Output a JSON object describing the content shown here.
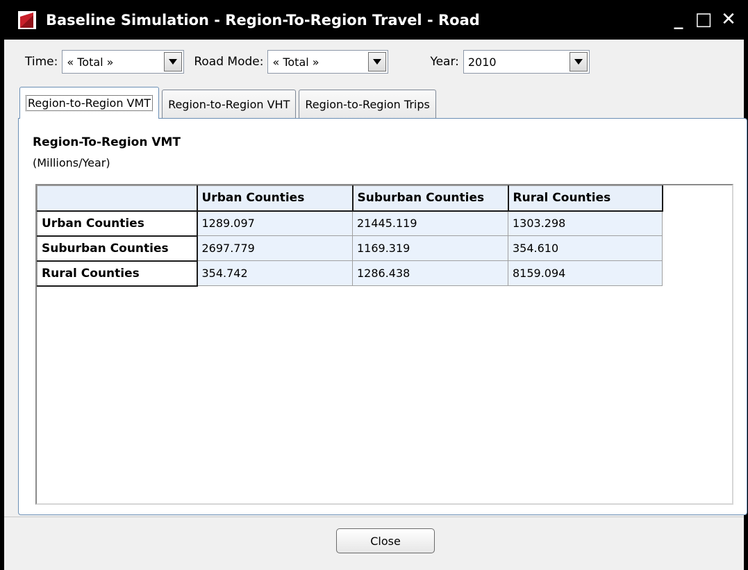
{
  "window": {
    "title": "Baseline Simulation - Region-To-Region Travel - Road",
    "minimize_glyph": "_",
    "maximize_glyph": "□",
    "close_glyph": "✕"
  },
  "toolbar": {
    "time_label": "Time:",
    "time_value": "« Total »",
    "road_mode_label": "Road Mode:",
    "road_mode_value": "« Total »",
    "year_label": "Year:",
    "year_value": "2010"
  },
  "tabs": [
    {
      "label": "Region-to-Region VMT",
      "active": true
    },
    {
      "label": "Region-to-Region VHT",
      "active": false
    },
    {
      "label": "Region-to-Region Trips",
      "active": false
    }
  ],
  "panel": {
    "heading": "Region-To-Region VMT",
    "subheading": "(Millions/Year)"
  },
  "table": {
    "columns": [
      "Urban Counties",
      "Suburban Counties",
      "Rural Counties"
    ],
    "rows": [
      {
        "label": "Urban Counties",
        "values": [
          "1289.097",
          "21445.119",
          "1303.298"
        ]
      },
      {
        "label": "Suburban Counties",
        "values": [
          "2697.779",
          "1169.319",
          "354.610"
        ]
      },
      {
        "label": "Rural Counties",
        "values": [
          "354.742",
          "1286.438",
          "8159.094"
        ]
      }
    ]
  },
  "footer": {
    "close_label": "Close"
  },
  "colors": {
    "titlebar_bg": "#000000",
    "logo_red": "#c8202a",
    "header_cell_bg": "#e8f0fa",
    "data_cell_bg": "#eaf2fc",
    "tab_border_active": "#6b8fb5"
  }
}
